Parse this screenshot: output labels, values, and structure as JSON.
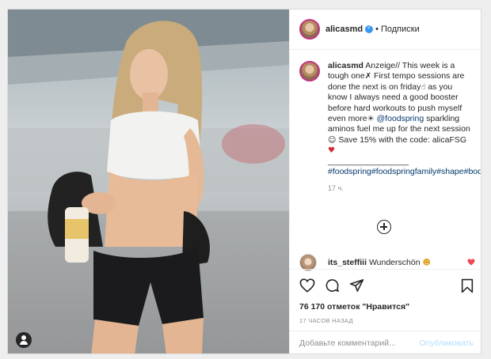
{
  "post": {
    "username": "alicasmd",
    "separator": "•",
    "follow_label": "Подписки",
    "caption": {
      "username": "alicasmd",
      "line1": " Anzeige// This week is a tough one",
      "line2": " First tempo sessions are done the next is on friday",
      "line3": " as you know I always need a good booster before hard workouts to push myself even more",
      "mention": "@foodspring",
      "line4": " sparkling aminos fuel me up for the next session",
      "line5": " Save 15% with the code: alicaFSG",
      "divider": "___________________",
      "hashtags": "#foodspring#foodspringfamily#shape#bodyshape#fittness#motivational",
      "time": "17 ч."
    },
    "comment": {
      "username": "its_steffiii",
      "text": "Wunderschön"
    },
    "likes_text": "76 170 отметок \"Нравится\"",
    "posted_time": "17 ЧАСОВ НАЗАД",
    "add_comment_placeholder": "Добавьте комментарий...",
    "publish_label": "Опубликовать"
  },
  "icons": {
    "like": "heart-icon",
    "comment": "comment-icon",
    "share": "share-icon",
    "save": "bookmark-icon",
    "load_more": "plus-circle-icon",
    "user_tag": "user-tag-icon"
  },
  "colors": {
    "text": "#262626",
    "secondary": "#8e8e8e",
    "link": "#00376b",
    "verified": "#3897f0",
    "like_red": "#ed4956",
    "publish_disabled": "#b2dffc"
  }
}
